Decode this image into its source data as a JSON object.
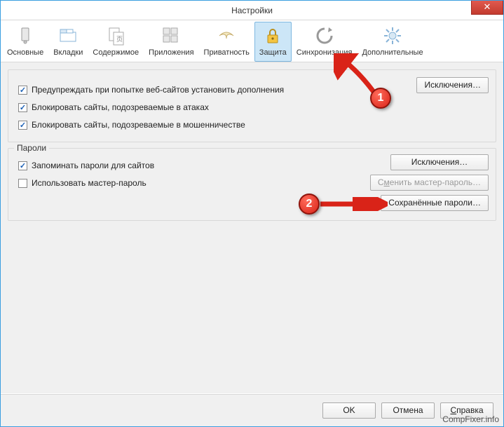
{
  "window": {
    "title": "Настройки",
    "close_symbol": "✕"
  },
  "toolbar": {
    "items": [
      {
        "label": "Основные",
        "icon": "general"
      },
      {
        "label": "Вкладки",
        "icon": "tabs"
      },
      {
        "label": "Содержимое",
        "icon": "content"
      },
      {
        "label": "Приложения",
        "icon": "apps"
      },
      {
        "label": "Приватность",
        "icon": "privacy"
      },
      {
        "label": "Защита",
        "icon": "security",
        "active": true
      },
      {
        "label": "Синхронизация",
        "icon": "sync"
      },
      {
        "label": "Дополнительные",
        "icon": "advanced"
      }
    ]
  },
  "section1": {
    "checks": [
      {
        "checked": true,
        "label": "Предупреждать при попытке веб-сайтов установить дополнения"
      },
      {
        "checked": true,
        "label": "Блокировать сайты, подозреваемые в атаках"
      },
      {
        "checked": true,
        "label": "Блокировать сайты, подозреваемые в мошенничестве"
      }
    ],
    "exceptions_btn": "Исключения…"
  },
  "section2": {
    "legend": "Пароли",
    "remember": {
      "checked": true,
      "label": "Запоминать пароли для сайтов"
    },
    "master": {
      "checked": false,
      "label": "Использовать мастер-пароль"
    },
    "exceptions_btn": "Исключения…",
    "change_master_btn": "Сменить мастер-пароль…",
    "saved_pw_btn": "Сохранённые пароли…"
  },
  "footer": {
    "ok": "OK",
    "cancel": "Отмена",
    "help": "Справка"
  },
  "annotations": {
    "badge1": "1",
    "badge2": "2"
  },
  "watermark": "CompFixer.info"
}
